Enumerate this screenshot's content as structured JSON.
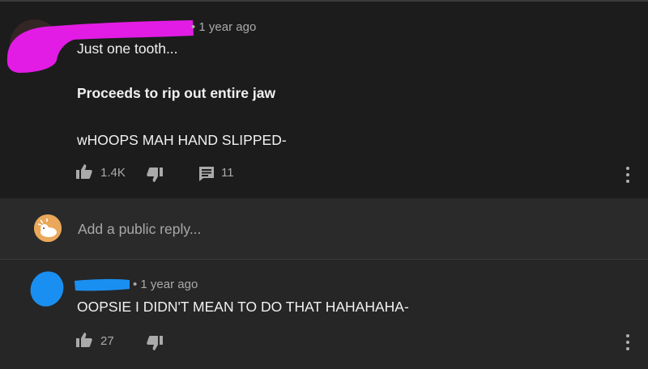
{
  "comment": {
    "timestamp": "• 1 year ago",
    "lines": [
      "Just one tooth...",
      "Proceeds to rip out entire jaw",
      "wHOOPS MAH HAND SLIPPED-"
    ],
    "likes": "1.4K",
    "reply_count": "11"
  },
  "reply_input": {
    "placeholder": "Add a public reply..."
  },
  "reply": {
    "timestamp": "• 1 year ago",
    "text": "OOPSIE I DIDN'T MEAN TO DO THAT HAHAHAHA-",
    "likes": "27"
  },
  "colors": {
    "background": "#1c1c1c",
    "reply_box": "#2a2a2a",
    "reply_comment_bg": "#262626",
    "redaction_pink": "#e21ce4",
    "redaction_blue": "#1a8ff2",
    "secondary_text": "#aaaaaa"
  },
  "icons": [
    "thumbs-up-icon",
    "thumbs-down-icon",
    "comment-icon",
    "more-vert-icon"
  ]
}
